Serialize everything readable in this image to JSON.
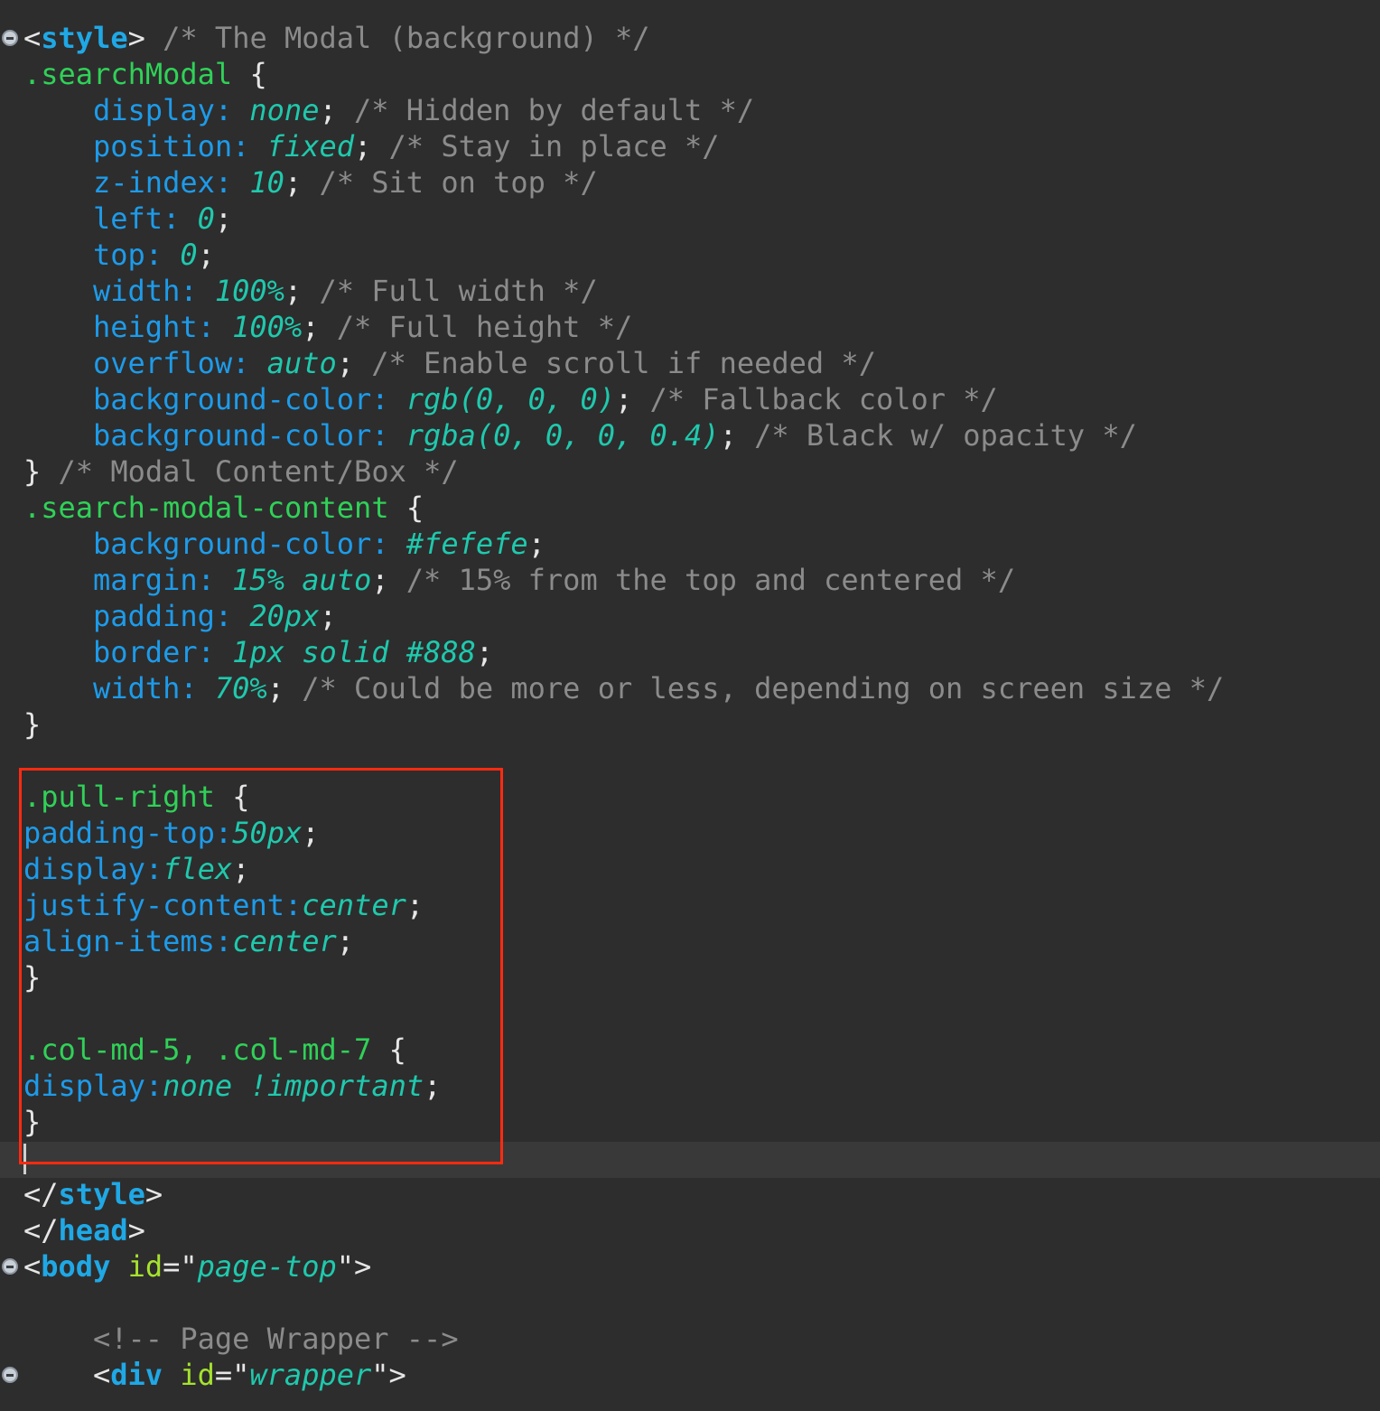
{
  "editor": {
    "highlight_color": "#ff2a10",
    "lines": [
      {
        "tokens": [
          {
            "c": "punct",
            "t": "<"
          },
          {
            "c": "tag",
            "t": "style"
          },
          {
            "c": "punct",
            "t": ">"
          },
          {
            "c": "cm",
            "t": " /* The Modal (background) */"
          }
        ]
      },
      {
        "tokens": [
          {
            "c": "sel",
            "t": ".searchModal"
          },
          {
            "c": "punct",
            "t": " {"
          }
        ]
      },
      {
        "tokens": [
          {
            "c": "prop",
            "t": "display:"
          },
          {
            "c": "val",
            "t": " none"
          },
          {
            "c": "punct",
            "t": ";"
          },
          {
            "c": "cm",
            "t": " /* Hidden by default */"
          }
        ]
      },
      {
        "tokens": [
          {
            "c": "prop",
            "t": "position:"
          },
          {
            "c": "val",
            "t": " fixed"
          },
          {
            "c": "punct",
            "t": ";"
          },
          {
            "c": "cm",
            "t": " /* Stay in place */"
          }
        ]
      },
      {
        "tokens": [
          {
            "c": "prop",
            "t": "z-index:"
          },
          {
            "c": "val",
            "t": " 10"
          },
          {
            "c": "punct",
            "t": ";"
          },
          {
            "c": "cm",
            "t": " /* Sit on top */"
          }
        ]
      },
      {
        "tokens": [
          {
            "c": "prop",
            "t": "left:"
          },
          {
            "c": "val",
            "t": " 0"
          },
          {
            "c": "punct",
            "t": ";"
          }
        ]
      },
      {
        "tokens": [
          {
            "c": "prop",
            "t": "top:"
          },
          {
            "c": "val",
            "t": " 0"
          },
          {
            "c": "punct",
            "t": ";"
          }
        ]
      },
      {
        "tokens": [
          {
            "c": "prop",
            "t": "width:"
          },
          {
            "c": "val",
            "t": " 100%"
          },
          {
            "c": "punct",
            "t": ";"
          },
          {
            "c": "cm",
            "t": " /* Full width */"
          }
        ]
      },
      {
        "tokens": [
          {
            "c": "prop",
            "t": "height:"
          },
          {
            "c": "val",
            "t": " 100%"
          },
          {
            "c": "punct",
            "t": ";"
          },
          {
            "c": "cm",
            "t": " /* Full height */"
          }
        ]
      },
      {
        "tokens": [
          {
            "c": "prop",
            "t": "overflow:"
          },
          {
            "c": "val",
            "t": " auto"
          },
          {
            "c": "punct",
            "t": ";"
          },
          {
            "c": "cm",
            "t": " /* Enable scroll if needed */"
          }
        ]
      },
      {
        "tokens": [
          {
            "c": "prop",
            "t": "background-color:"
          },
          {
            "c": "val",
            "t": " rgb(0, 0, 0)"
          },
          {
            "c": "punct",
            "t": ";"
          },
          {
            "c": "cm",
            "t": " /* Fallback color */"
          }
        ]
      },
      {
        "tokens": [
          {
            "c": "prop",
            "t": "background-color:"
          },
          {
            "c": "val",
            "t": " rgba(0, 0, 0, 0.4)"
          },
          {
            "c": "punct",
            "t": ";"
          },
          {
            "c": "cm",
            "t": " /* Black w/ opacity */"
          }
        ]
      },
      {
        "tokens": [
          {
            "c": "punct",
            "t": "}"
          },
          {
            "c": "cm",
            "t": " /* Modal Content/Box */"
          }
        ]
      },
      {
        "tokens": [
          {
            "c": "sel",
            "t": ".search-modal-content"
          },
          {
            "c": "punct",
            "t": " {"
          }
        ]
      },
      {
        "tokens": [
          {
            "c": "prop",
            "t": "background-color:"
          },
          {
            "c": "val",
            "t": " #fefefe"
          },
          {
            "c": "punct",
            "t": ";"
          }
        ]
      },
      {
        "tokens": [
          {
            "c": "prop",
            "t": "margin:"
          },
          {
            "c": "val",
            "t": " 15% auto"
          },
          {
            "c": "punct",
            "t": ";"
          },
          {
            "c": "cm",
            "t": " /* 15% from the top and centered */"
          }
        ]
      },
      {
        "tokens": [
          {
            "c": "prop",
            "t": "padding:"
          },
          {
            "c": "val",
            "t": " 20px"
          },
          {
            "c": "punct",
            "t": ";"
          }
        ]
      },
      {
        "tokens": [
          {
            "c": "prop",
            "t": "border:"
          },
          {
            "c": "val",
            "t": " 1px solid #888"
          },
          {
            "c": "punct",
            "t": ";"
          }
        ]
      },
      {
        "tokens": [
          {
            "c": "prop",
            "t": "width:"
          },
          {
            "c": "val",
            "t": " 70%"
          },
          {
            "c": "punct",
            "t": ";"
          },
          {
            "c": "cm",
            "t": " /* Could be more or less, depending on screen size */"
          }
        ]
      },
      {
        "tokens": [
          {
            "c": "punct",
            "t": "}"
          }
        ]
      },
      {
        "tokens": []
      },
      {
        "tokens": [
          {
            "c": "sel",
            "t": ".pull-right"
          },
          {
            "c": "punct",
            "t": " {"
          }
        ]
      },
      {
        "tokens": [
          {
            "c": "prop",
            "t": "padding-top:"
          },
          {
            "c": "val",
            "t": "50px"
          },
          {
            "c": "punct",
            "t": ";"
          }
        ]
      },
      {
        "tokens": [
          {
            "c": "prop",
            "t": "display:"
          },
          {
            "c": "val",
            "t": "flex"
          },
          {
            "c": "punct",
            "t": ";"
          }
        ]
      },
      {
        "tokens": [
          {
            "c": "prop",
            "t": "justify-content:"
          },
          {
            "c": "val",
            "t": "center"
          },
          {
            "c": "punct",
            "t": ";"
          }
        ]
      },
      {
        "tokens": [
          {
            "c": "prop",
            "t": "align-items:"
          },
          {
            "c": "val",
            "t": "center"
          },
          {
            "c": "punct",
            "t": ";"
          }
        ]
      },
      {
        "tokens": [
          {
            "c": "punct",
            "t": "}"
          }
        ]
      },
      {
        "tokens": []
      },
      {
        "tokens": [
          {
            "c": "sel",
            "t": ".col-md-5, .col-md-7"
          },
          {
            "c": "punct",
            "t": " {"
          }
        ]
      },
      {
        "tokens": [
          {
            "c": "prop",
            "t": "display:"
          },
          {
            "c": "val",
            "t": "none !important"
          },
          {
            "c": "punct",
            "t": ";"
          }
        ]
      },
      {
        "tokens": [
          {
            "c": "punct",
            "t": "}"
          }
        ]
      },
      {
        "tokens": []
      },
      {
        "tokens": [
          {
            "c": "punct",
            "t": "</"
          },
          {
            "c": "tag",
            "t": "style"
          },
          {
            "c": "punct",
            "t": ">"
          }
        ]
      },
      {
        "tokens": [
          {
            "c": "punct",
            "t": "</"
          },
          {
            "c": "tag",
            "t": "head"
          },
          {
            "c": "punct",
            "t": ">"
          }
        ]
      },
      {
        "tokens": [
          {
            "c": "punct",
            "t": "<"
          },
          {
            "c": "tag",
            "t": "body"
          },
          {
            "c": "punct",
            "t": " "
          },
          {
            "c": "attr",
            "t": "id"
          },
          {
            "c": "punct",
            "t": "=\""
          },
          {
            "c": "val",
            "t": "page-top"
          },
          {
            "c": "punct",
            "t": "\">"
          }
        ]
      },
      {
        "tokens": []
      },
      {
        "tokens": [
          {
            "c": "cm",
            "t": "<!-- Page Wrapper -->"
          }
        ]
      },
      {
        "tokens": [
          {
            "c": "punct",
            "t": "<"
          },
          {
            "c": "tag",
            "t": "div"
          },
          {
            "c": "punct",
            "t": " "
          },
          {
            "c": "attr",
            "t": "id"
          },
          {
            "c": "punct",
            "t": "=\""
          },
          {
            "c": "val",
            "t": "wrapper"
          },
          {
            "c": "punct",
            "t": "\">"
          }
        ]
      }
    ]
  }
}
